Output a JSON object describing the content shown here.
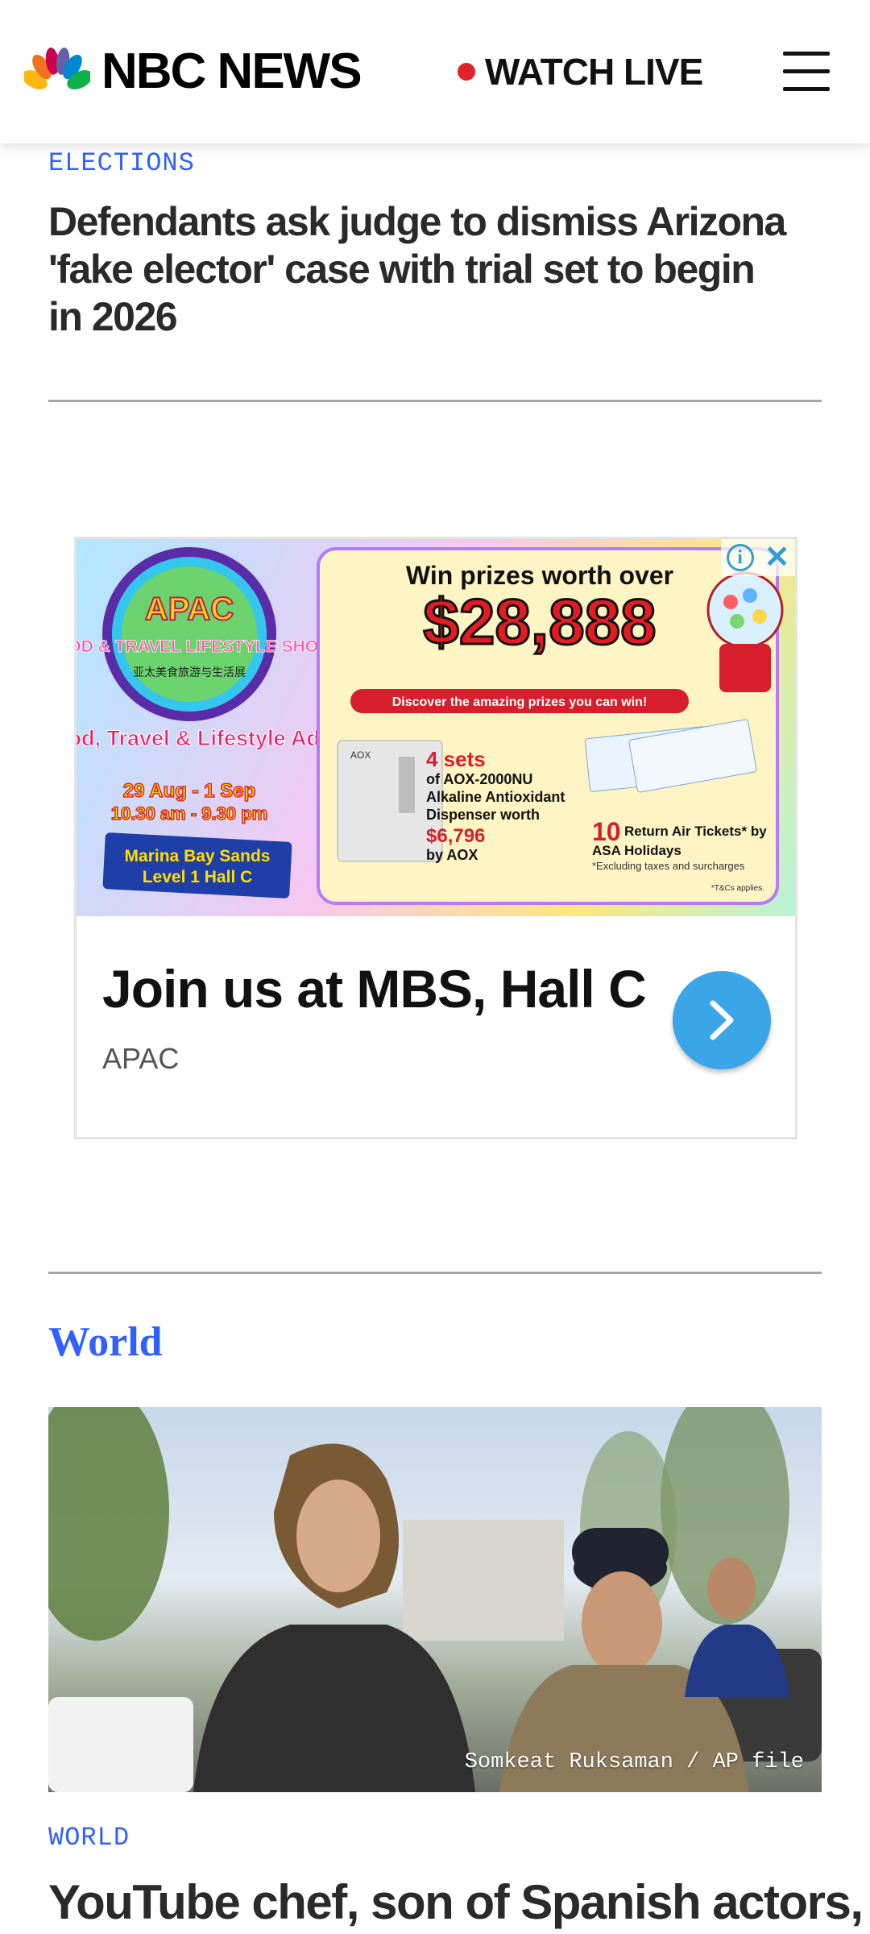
{
  "header": {
    "logo_text": "NBC NEWS",
    "watch_live_label": "WATCH LIVE",
    "icons": {
      "logo": "nbc-peacock-icon",
      "menu": "hamburger-menu-icon",
      "live": "live-dot-icon"
    }
  },
  "top_article": {
    "eyebrow": "ELECTIONS",
    "headline": "Defendants ask judge to dismiss Arizona 'fake elector' case with trial set to begin in 2026"
  },
  "ad": {
    "banner": {
      "show_name": "APAC",
      "show_subtitle": "FOOD & TRAVEL LIFESTYLE SHOW",
      "show_chinese": "亚太美食旅游与生活展",
      "tagline": "Tasty Food, Travel & Lifestyle Adventure",
      "dates": "29 Aug - 1 Sep",
      "hours": "10.30 am - 9.30 pm",
      "venue_line1": "Marina Bay Sands",
      "venue_line2": "Level 1 Hall C",
      "prize_heading": "Win prizes worth over",
      "prize_amount": "$28,888",
      "prize_sub": "Discover the amazing prizes you can win!",
      "prize1_count": "4 sets",
      "prize1_desc_1": "of AOX-2000NU",
      "prize1_desc_2": "Alkaline Antioxidant",
      "prize1_desc_3": "Dispenser worth",
      "prize1_value": "$6,796",
      "prize1_by": "by AOX",
      "prize2_count": "10",
      "prize2_desc_1": "Return Air Tickets* by",
      "prize2_desc_2": "ASA Holidays",
      "prize2_note": "*Excluding taxes and surcharges",
      "tcs": "*T&Cs applies.",
      "device_label": "AOX"
    },
    "cta_title": "Join us at MBS, Hall C",
    "advertiser": "APAC",
    "icons": {
      "info": "ad-info-icon",
      "close": "ad-close-icon",
      "arrow": "chevron-right-icon"
    },
    "colors": {
      "arrow_bg": "#3aa6e8"
    }
  },
  "world_section": {
    "title": "World",
    "photo_credit": "Somkeat Ruksaman / AP file",
    "eyebrow": "WORLD",
    "headline": "YouTube chef, son of Spanish actors,"
  },
  "colors": {
    "accent_blue": "#3061ff",
    "live_red": "#e0222c"
  }
}
